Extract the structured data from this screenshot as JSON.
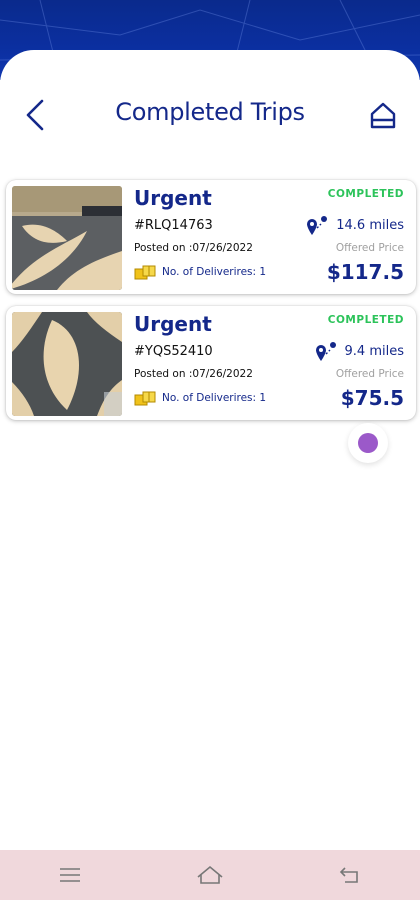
{
  "header": {
    "title": "Completed Trips"
  },
  "trips": [
    {
      "priority": "Urgent",
      "order_id": "#RLQ14763",
      "posted": "Posted on :07/26/2022",
      "deliveries": "No. of Deliverires: 1",
      "status": "COMPLETED",
      "distance": "14.6 miles",
      "offered_label": "Offered Price",
      "price": "$117.5"
    },
    {
      "priority": "Urgent",
      "order_id": "#YQS52410",
      "posted": "Posted on :07/26/2022",
      "deliveries": "No. of Deliverires: 1",
      "status": "COMPLETED",
      "distance": "9.4 miles",
      "offered_label": "Offered Price",
      "price": "$75.5"
    }
  ],
  "icons": {
    "back": "chevron-left-icon",
    "home": "home-icon",
    "route": "route-pin-icon",
    "box": "package-icon",
    "nav_menu": "menu-icon",
    "nav_home": "home-outline-icon",
    "nav_back": "back-arrow-icon"
  },
  "colors": {
    "brand": "#14288a",
    "status_completed": "#2cc35a",
    "accent_dot": "#9b59c9",
    "nav_bar": "#f0d8dc"
  }
}
